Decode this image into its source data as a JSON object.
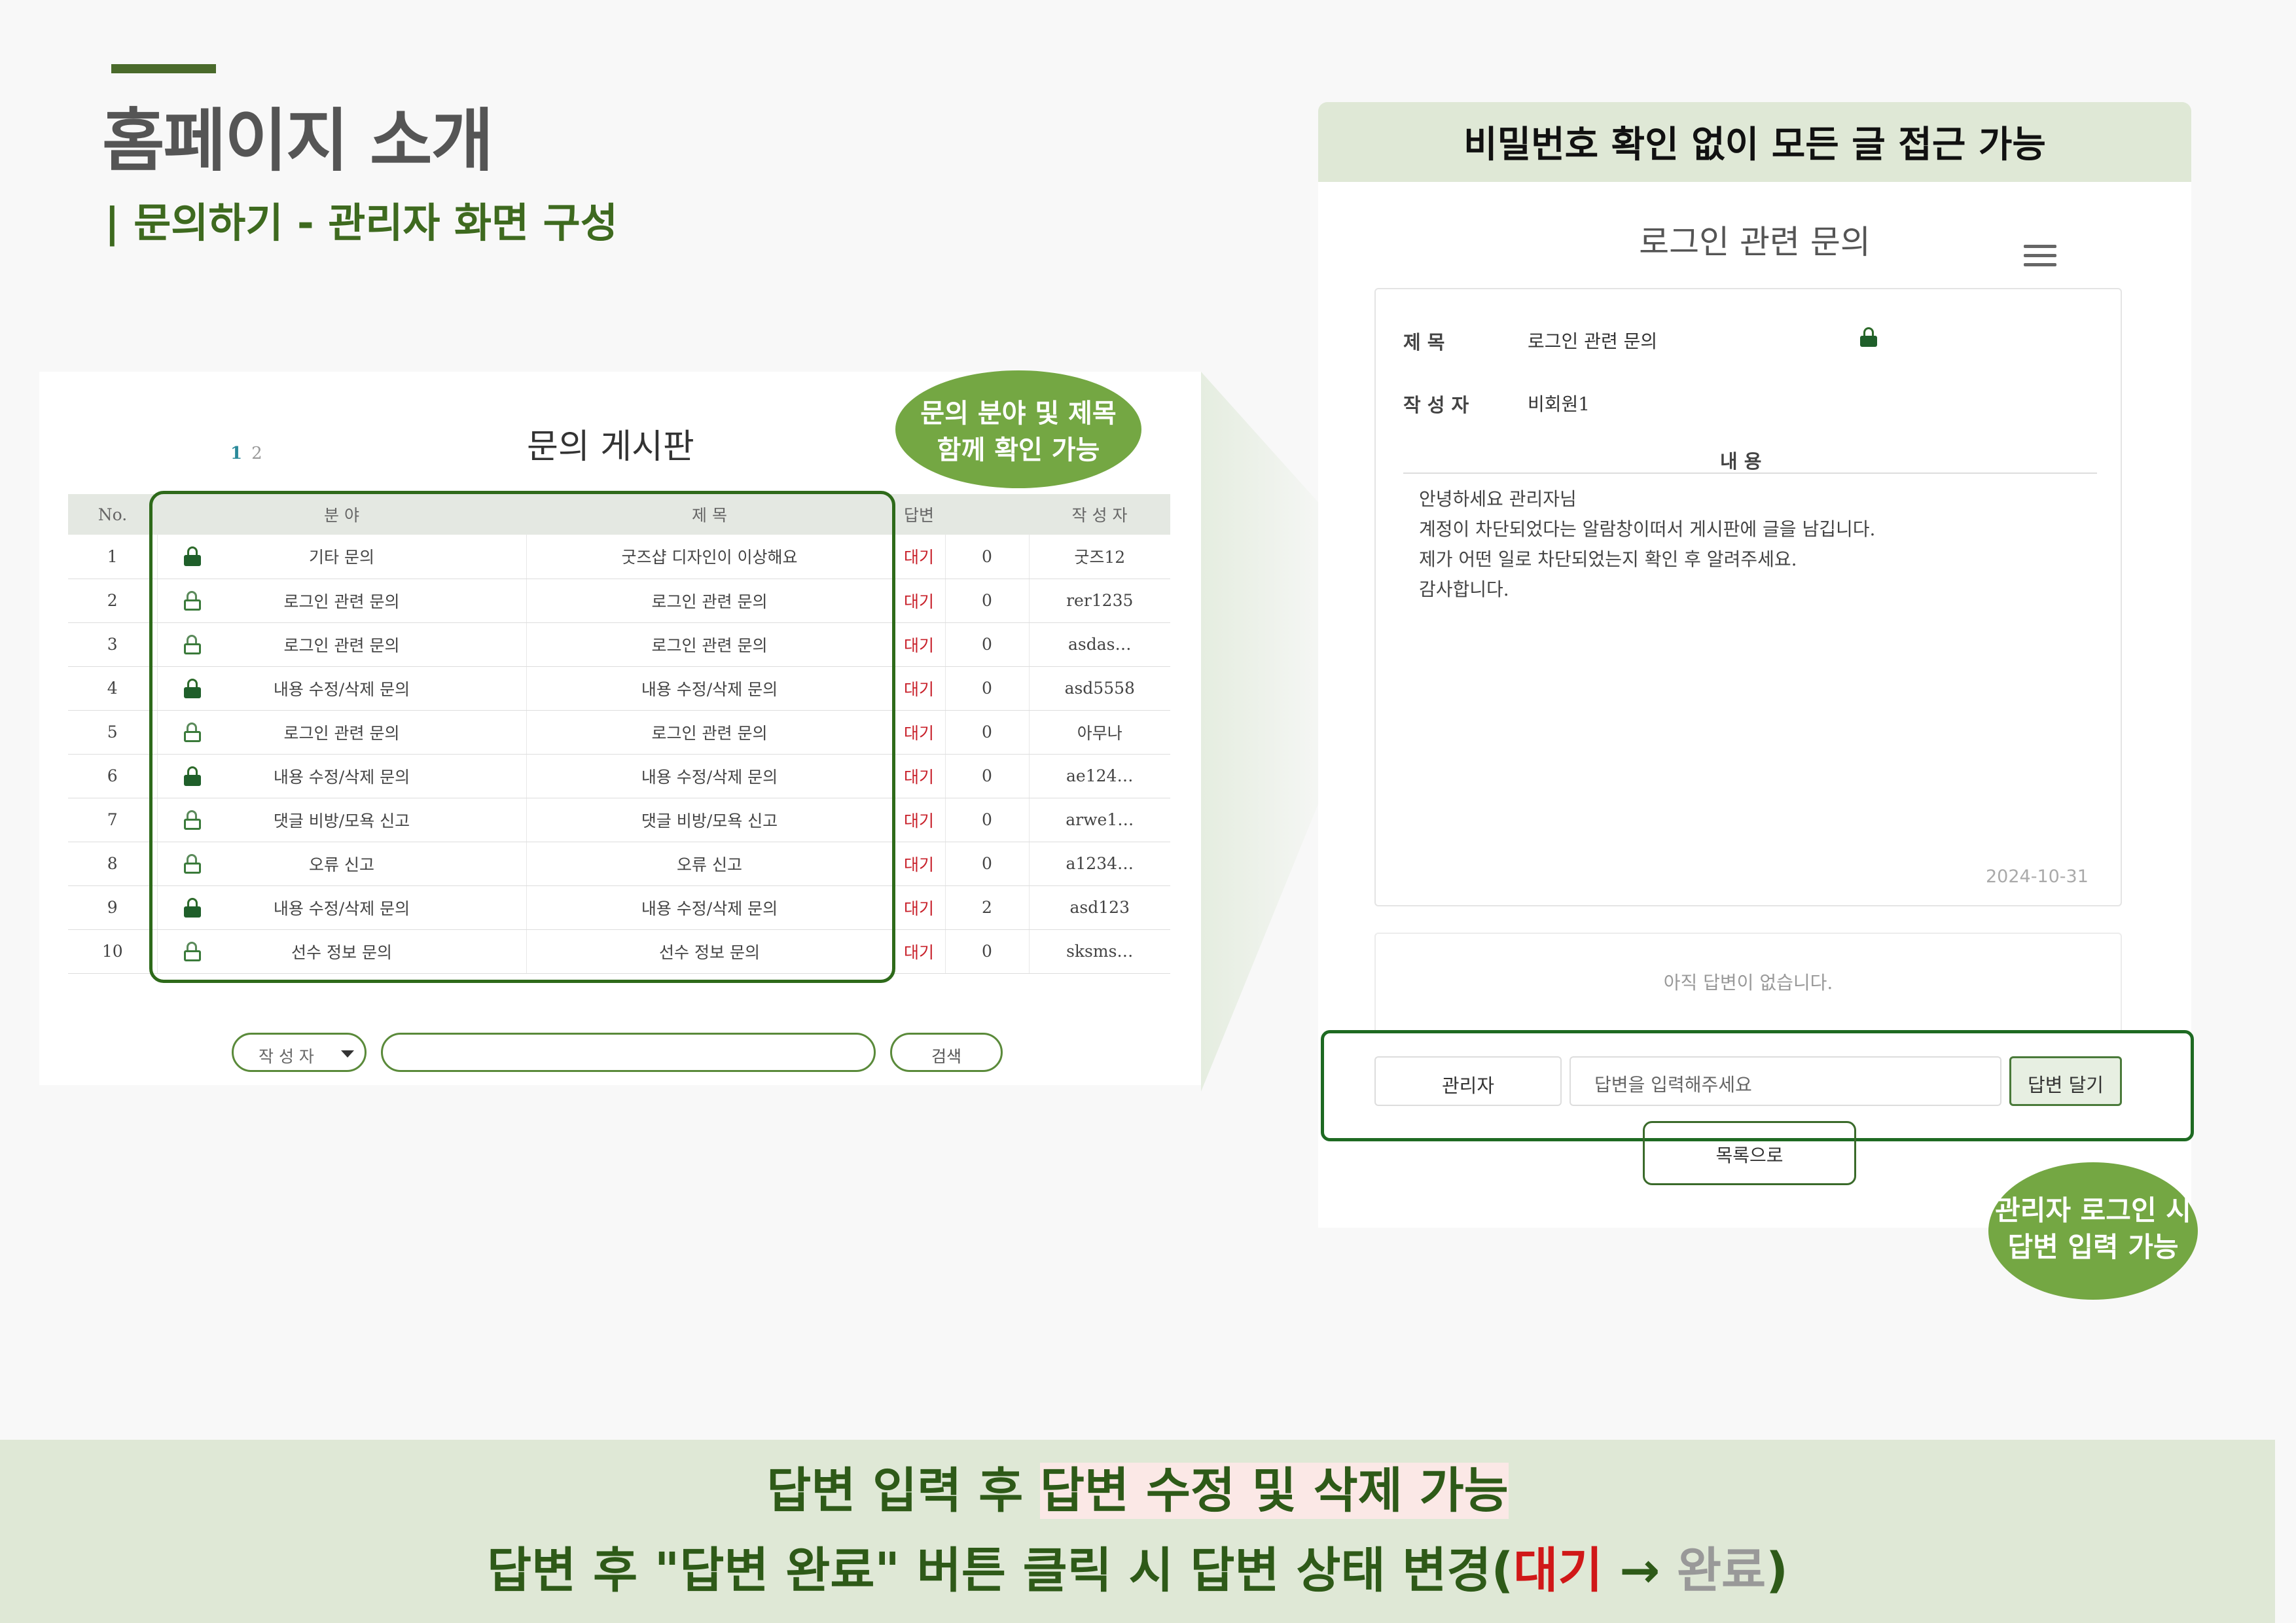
{
  "slide": {
    "title": "홈페이지 소개",
    "subtitle": "| 문의하기 - 관리자 화면 구성"
  },
  "board": {
    "title": "문의 게시판",
    "pages": [
      "1",
      "2"
    ],
    "columns": [
      "No.",
      "분 야",
      "제 목",
      "답변",
      "",
      "작 성 자"
    ],
    "rows": [
      {
        "no": "1",
        "category": "기타 문의",
        "locked": true,
        "title": "굿즈샵 디자인이 이상해요",
        "status": "대기",
        "count": "0",
        "author": "굿즈12"
      },
      {
        "no": "2",
        "category": "로그인 관련 문의",
        "locked": false,
        "title": "로그인 관련 문의",
        "status": "대기",
        "count": "0",
        "author": "rer1235"
      },
      {
        "no": "3",
        "category": "로그인 관련 문의",
        "locked": false,
        "title": "로그인 관련 문의",
        "status": "대기",
        "count": "0",
        "author": "asdas…"
      },
      {
        "no": "4",
        "category": "내용 수정/삭제 문의",
        "locked": true,
        "title": "내용 수정/삭제 문의",
        "status": "대기",
        "count": "0",
        "author": "asd5558"
      },
      {
        "no": "5",
        "category": "로그인 관련 문의",
        "locked": false,
        "title": "로그인 관련 문의",
        "status": "대기",
        "count": "0",
        "author": "아무나"
      },
      {
        "no": "6",
        "category": "내용 수정/삭제 문의",
        "locked": true,
        "title": "내용 수정/삭제 문의",
        "status": "대기",
        "count": "0",
        "author": "ae124…"
      },
      {
        "no": "7",
        "category": "댓글 비방/모욕 신고",
        "locked": false,
        "title": "댓글 비방/모욕 신고",
        "status": "대기",
        "count": "0",
        "author": "arwe1…"
      },
      {
        "no": "8",
        "category": "오류 신고",
        "locked": false,
        "title": "오류 신고",
        "status": "대기",
        "count": "0",
        "author": "a1234…"
      },
      {
        "no": "9",
        "category": "내용 수정/삭제 문의",
        "locked": true,
        "title": "내용 수정/삭제 문의",
        "status": "대기",
        "count": "2",
        "author": "asd123"
      },
      {
        "no": "10",
        "category": "선수 정보 문의",
        "locked": false,
        "title": "선수 정보 문의",
        "status": "대기",
        "count": "0",
        "author": "sksms…"
      }
    ],
    "search": {
      "select_value": "작 성 자",
      "input_value": "",
      "button": "검색"
    }
  },
  "callouts": {
    "board_note": "문의 분야 및 제목\n함께 확인 가능",
    "reply_note": "관리자 로그인 시\n답변 입력 가능"
  },
  "detail": {
    "header": "비밀번호 확인 없이 모든 글 접근 가능",
    "title": "로그인 관련 문의",
    "subject_label": "제 목",
    "subject_value": "로그인 관련 문의",
    "author_label": "작 성 자",
    "author_value": "비회원1",
    "content_label": "내 용",
    "content_lines": [
      "안녕하세요 관리자님",
      "계정이 차단되었다는 알람창이떠서 게시판에 글을 남깁니다.",
      "제가 어떤 일로 차단되었는지 확인 후 알려주세요.",
      "감사합니다."
    ],
    "date": "2024-10-31",
    "no_reply": "아직 답변이 없습니다.",
    "admin_name": "관리자",
    "reply_placeholder": "답변을 입력해주세요",
    "reply_button": "답변 달기",
    "back_button": "목록으로"
  },
  "footer": {
    "line1_a": "답변 입력 후 ",
    "line1_hl": "답변 수정 및 삭제 가능",
    "line2_a": "답변 후 \"답변 완료\" 버튼 클릭 시 답변 상태 변경(",
    "line2_red": "대기",
    "line2_arrow": " → ",
    "line2_gray": "완료",
    "line2_end": ")"
  },
  "colors": {
    "accent": "#4a6a2b",
    "status_wait": "#d01818",
    "callout": "#74a743",
    "header_bg": "#dfe8d6"
  }
}
